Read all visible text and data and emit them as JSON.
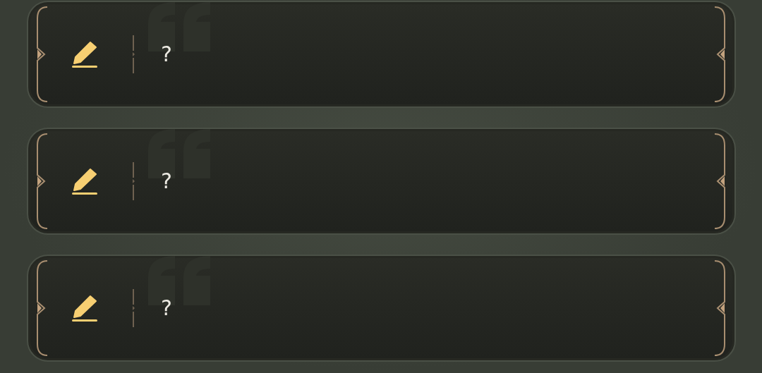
{
  "cards": [
    {
      "text": "?"
    },
    {
      "text": "?"
    },
    {
      "text": "?"
    }
  ]
}
